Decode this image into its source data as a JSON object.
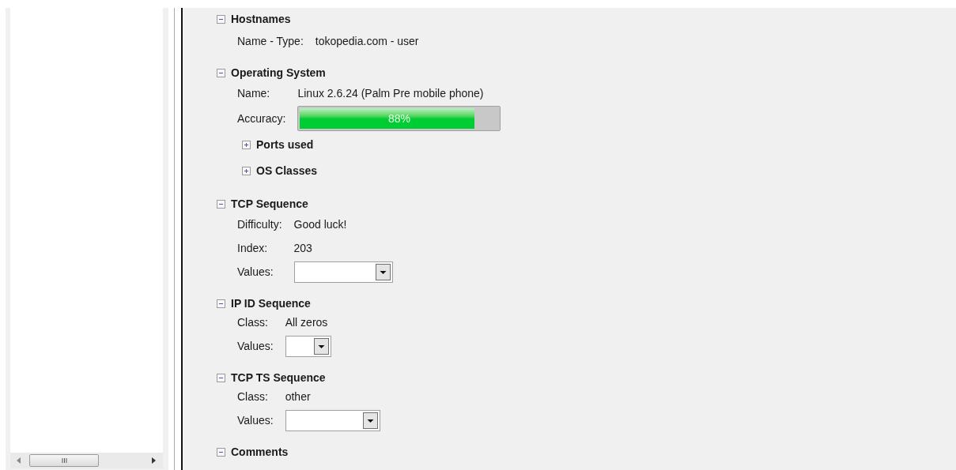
{
  "sections": [
    {
      "title": "Hostnames",
      "expanded": true,
      "rows": [
        {
          "kind": "text",
          "label": "Name - Type:",
          "value": "tokopedia.com - user"
        }
      ]
    },
    {
      "title": "Operating System",
      "expanded": true,
      "rows": [
        {
          "kind": "text",
          "label": "Name:",
          "value": "Linux 2.6.24 (Palm Pre mobile phone)"
        },
        {
          "kind": "progress",
          "label": "Accuracy:",
          "level": 0.88,
          "reading": "88%"
        }
      ],
      "subsections": [
        {
          "title": "Ports used",
          "expanded": false
        },
        {
          "title": "OS Classes",
          "expanded": false
        }
      ]
    },
    {
      "title": "TCP Sequence",
      "expanded": true,
      "rows": [
        {
          "kind": "text",
          "label": "Difficulty:",
          "value": "Good luck!"
        },
        {
          "kind": "text",
          "label": "Index:",
          "value": "203"
        },
        {
          "kind": "dropdown",
          "label": "Values:"
        }
      ]
    },
    {
      "title": "IP ID Sequence",
      "expanded": true,
      "rows": [
        {
          "kind": "text",
          "label": "Class:",
          "value": "All zeros"
        },
        {
          "kind": "dropdown",
          "label": "Values:"
        }
      ]
    },
    {
      "title": "TCP TS Sequence",
      "expanded": true,
      "rows": [
        {
          "kind": "text",
          "label": "Class:",
          "value": "other"
        },
        {
          "kind": "dropdown",
          "label": "Values:"
        }
      ]
    },
    {
      "title": "Comments",
      "expanded": true
    }
  ]
}
